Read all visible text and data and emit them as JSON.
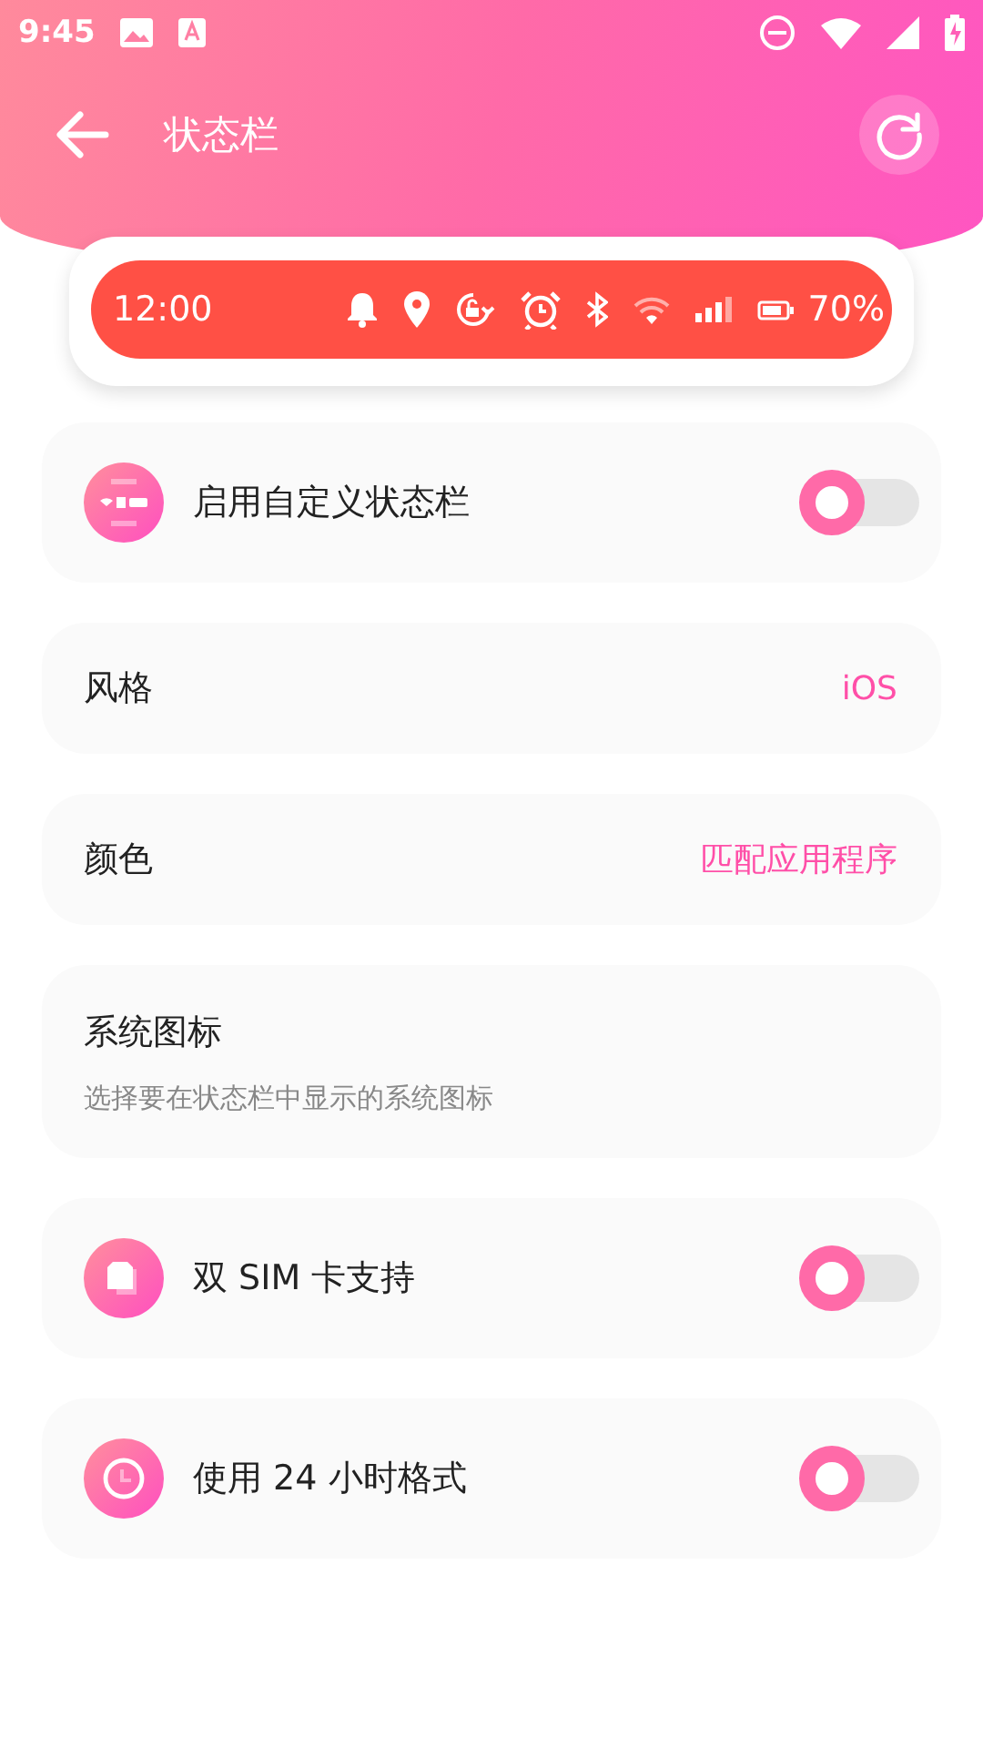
{
  "system_status": {
    "time": "9:45"
  },
  "app_bar": {
    "title": "状态栏"
  },
  "preview": {
    "time": "12:00",
    "battery": "70%"
  },
  "settings": [
    {
      "kind": "toggle",
      "label": "启用自定义状态栏",
      "on": false
    },
    {
      "kind": "value",
      "label": "风格",
      "value": "iOS"
    },
    {
      "kind": "value",
      "label": "颜色",
      "value": "匹配应用程序"
    },
    {
      "kind": "info",
      "label": "系统图标",
      "description": "选择要在状态栏中显示的系统图标"
    },
    {
      "kind": "toggle",
      "label": "双 SIM 卡支持",
      "on": false
    },
    {
      "kind": "toggle",
      "label": "使用 24 小时格式",
      "on": false
    }
  ]
}
